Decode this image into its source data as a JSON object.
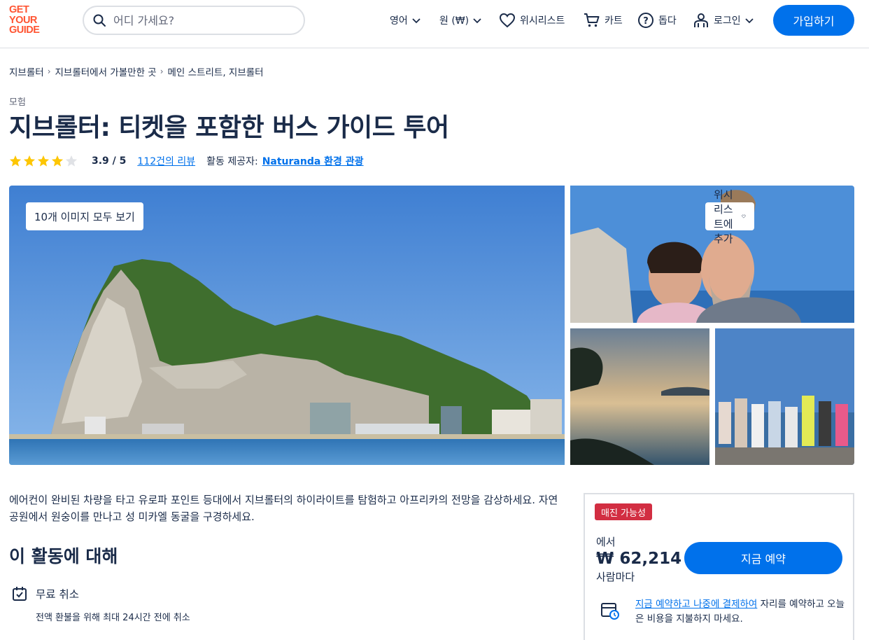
{
  "header": {
    "logo_lines": [
      "GET",
      "YOUR",
      "GUIDE"
    ],
    "search_placeholder": "어디 가세요?",
    "language": "영어",
    "currency": "원 (₩)",
    "wishlist": "위시리스트",
    "cart": "카트",
    "help": "돕다",
    "login": "로그인",
    "signup": "가입하기"
  },
  "breadcrumb": [
    "지브롤터",
    "지브롤터에서 가볼만한 곳",
    "메인 스트리트, 지브롤터"
  ],
  "activity": {
    "category": "모험",
    "title": "지브롤터: 티켓을 포함한 버스 가이드 투어",
    "rating": "3.9 / 5",
    "rating_value": 3.9,
    "stars_max": 5,
    "reviews": "112건의 리뷰",
    "provider_label": "활동 제공자:",
    "provider": "Naturanda 환경 관광"
  },
  "gallery": {
    "view_all": "10개 이미지 모두 보기",
    "add_wishlist": "위시리스트에 추가"
  },
  "description": "에어컨이 완비된 차량을 타고 유로파 포인트 등대에서 지브롤터의 하이라이트를 탐험하고 아프리카의 전망을 감상하세요. 자연 공원에서 원숭이를 만나고 성 미카엘 동굴을 구경하세요.",
  "about": {
    "heading": "이 활동에 대해",
    "features": [
      {
        "title": "무료 취소",
        "subtitle": "전액 환불을 위해 최대 24시간 전에 취소",
        "icon": "calendar-check-icon"
      }
    ]
  },
  "booking": {
    "badge": "매진 가능성",
    "from": "에서",
    "price": "₩ 62,214",
    "per_person": "사람마다",
    "book_button": "지금 예약",
    "pay_later_link": "지금 예약하고 나중에 결제하여",
    "pay_later_rest": " 자리를 예약하고 오늘은 비용을 지불하지 마세요."
  },
  "colors": {
    "brand": "#ff5533",
    "primary": "#0071eb",
    "text": "#1a2b49",
    "badge": "#d22e42",
    "star": "#fdc603"
  }
}
